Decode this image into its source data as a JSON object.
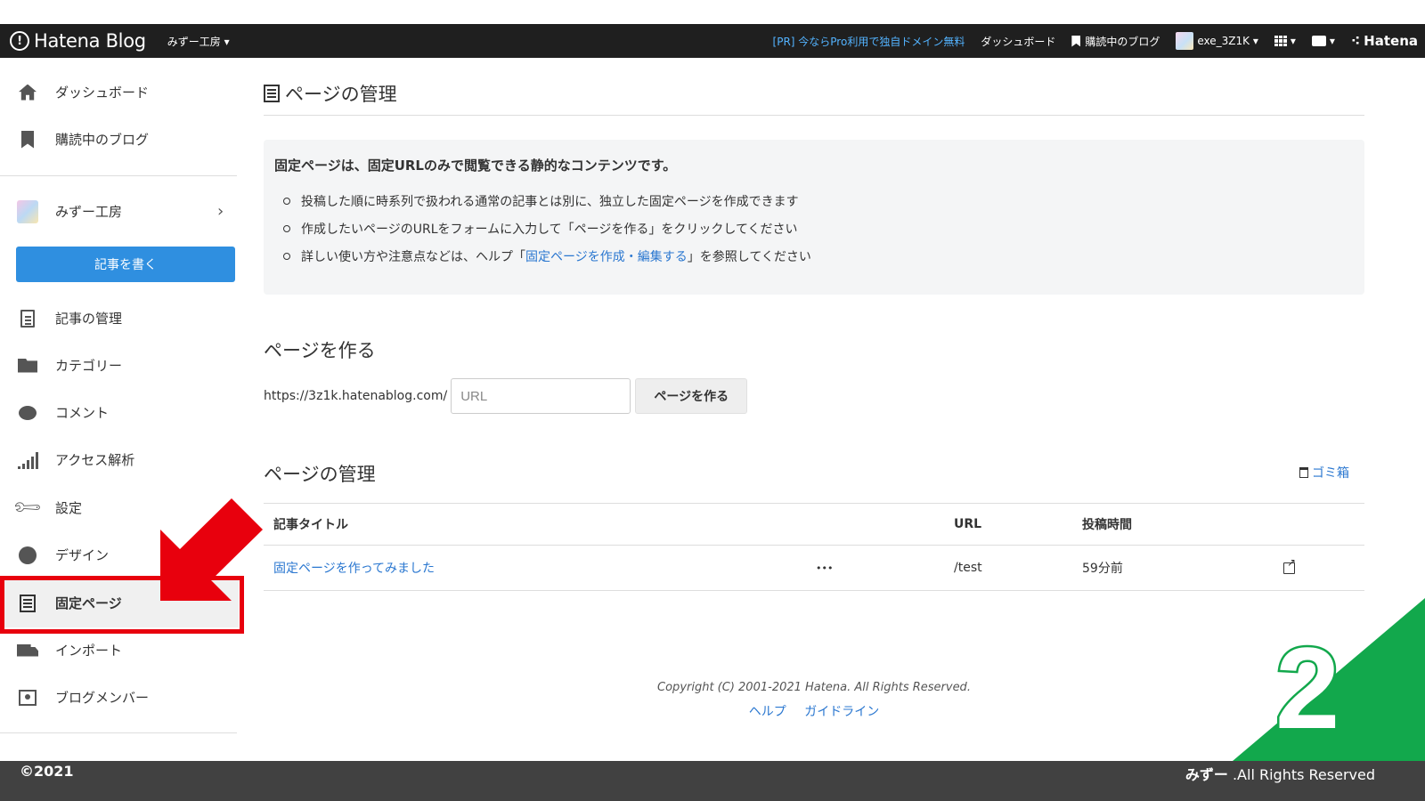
{
  "header": {
    "brand": "Hatena Blog",
    "blog_selector": "みずー工房 ▾",
    "pr_link": "[PR] 今ならPro利用で独自ドメイン無料",
    "dashboard": "ダッシュボード",
    "reading_blogs": "購読中のブログ",
    "user": "exe_3Z1K ▾",
    "hatena": "Hatena"
  },
  "sidebar": {
    "items": [
      {
        "label": "ダッシュボード",
        "icon": "home-icon"
      },
      {
        "label": "購読中のブログ",
        "icon": "bookmark-icon"
      },
      {
        "label": "みずー工房",
        "icon": "blog-avatar"
      },
      {
        "label": "記事の管理",
        "icon": "document-icon"
      },
      {
        "label": "カテゴリー",
        "icon": "folder-icon"
      },
      {
        "label": "コメント",
        "icon": "comment-icon"
      },
      {
        "label": "アクセス解析",
        "icon": "bar-chart-icon"
      },
      {
        "label": "設定",
        "icon": "wrench-icon"
      },
      {
        "label": "デザイン",
        "icon": "palette-icon"
      },
      {
        "label": "固定ページ",
        "icon": "pages-icon"
      },
      {
        "label": "インポート",
        "icon": "truck-icon"
      },
      {
        "label": "ブログメンバー",
        "icon": "members-icon"
      }
    ],
    "write_button": "記事を書く"
  },
  "main": {
    "title": "ページの管理",
    "info": {
      "heading": "固定ページは、固定URLのみで閲覧できる静的なコンテンツです。",
      "bullet1": "投稿した順に時系列で扱われる通常の記事とは別に、独立した固定ページを作成できます",
      "bullet2": "作成したいページのURLをフォームに入力して「ページを作る」をクリックしてください",
      "bullet3_pre": "詳しい使い方や注意点などは、ヘルプ「",
      "bullet3_link": "固定ページを作成・編集する",
      "bullet3_post": "」を参照してください"
    },
    "create": {
      "heading": "ページを作る",
      "url_prefix": "https://3z1k.hatenablog.com/",
      "placeholder": "URL",
      "button": "ページを作る"
    },
    "manage": {
      "heading": "ページの管理",
      "trash": "ゴミ箱",
      "columns": {
        "title": "記事タイトル",
        "url": "URL",
        "posted": "投稿時間"
      },
      "rows": [
        {
          "title": "固定ページを作ってみました",
          "more": "•••",
          "url": "/test",
          "posted": "59分前"
        }
      ]
    },
    "footer": {
      "copyright": "Copyright (C) 2001-2021 Hatena. All Rights Reserved.",
      "help": "ヘルプ",
      "guideline": "ガイドライン"
    }
  },
  "overlay": {
    "step_number": "2",
    "bottom_left": "©2021",
    "bottom_right_bold": "みずー",
    "bottom_right": " .All Rights Reserved",
    "accent_red": "#e8000d",
    "accent_green": "#12a84c"
  }
}
